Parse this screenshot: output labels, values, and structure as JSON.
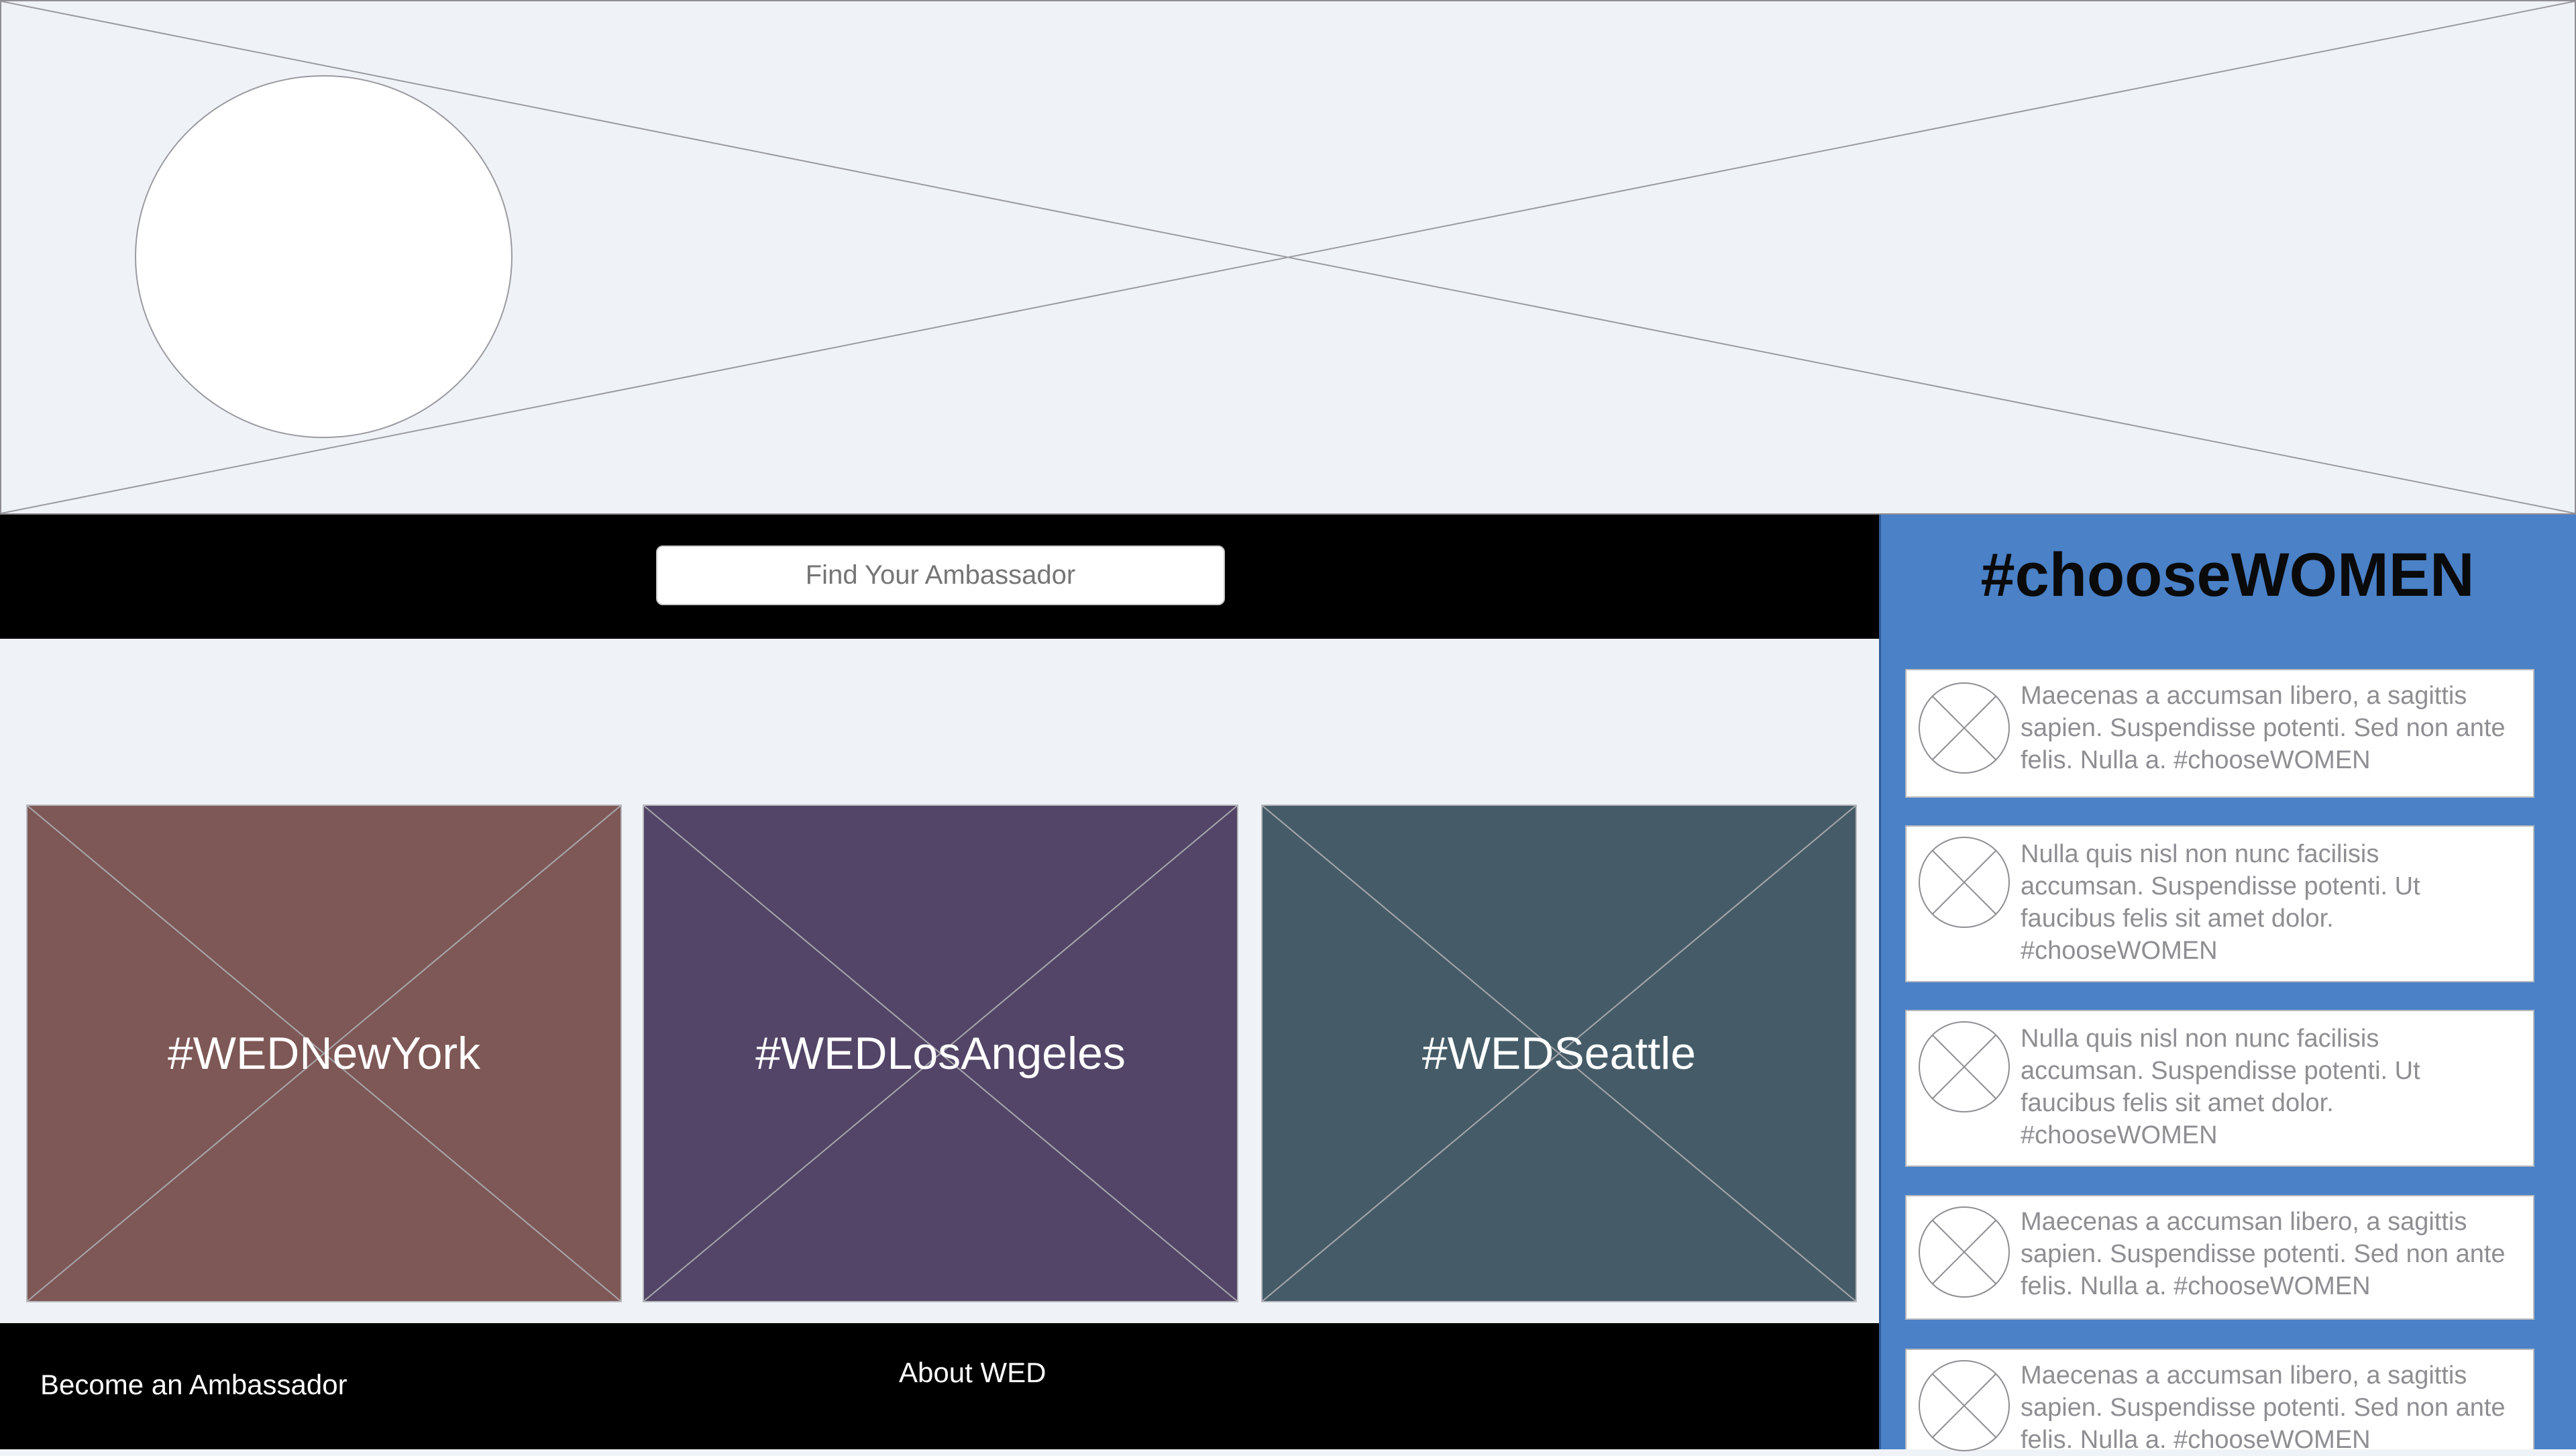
{
  "search": {
    "placeholder": "Find Your Ambassador"
  },
  "cards": [
    {
      "label": "#WEDNewYork",
      "color": "#7e5856"
    },
    {
      "label": "#WEDLosAngeles",
      "color": "#534567"
    },
    {
      "label": "#WEDSeattle",
      "color": "#455c68"
    }
  ],
  "footer": {
    "become_label": "Become an Ambassador",
    "about_label": "About WED"
  },
  "sidebar": {
    "title": "#chooseWOMEN",
    "background": "#4a81c7",
    "items": [
      {
        "text": "Maecenas a accumsan libero, a sagittis sapien. Suspendisse potenti. Sed non ante felis. Nulla a. #chooseWOMEN"
      },
      {
        "text": "Nulla quis nisl non nunc facilisis accumsan. Suspendisse potenti. Ut faucibus felis sit amet dolor. #chooseWOMEN"
      },
      {
        "text": "Nulla quis nisl non nunc facilisis accumsan. Suspendisse potenti. Ut faucibus felis sit amet dolor. #chooseWOMEN"
      },
      {
        "text": "Maecenas a accumsan libero, a sagittis sapien. Suspendisse potenti. Sed non ante felis. Nulla a. #chooseWOMEN"
      },
      {
        "text": "Maecenas a accumsan libero, a sagittis sapien. Suspendisse potenti. Sed non ante felis. Nulla a. #chooseWOMEN"
      }
    ]
  },
  "icons": {
    "hero": "image-placeholder-icon",
    "avatar": "avatar-placeholder",
    "thumb": "image-placeholder-icon"
  }
}
